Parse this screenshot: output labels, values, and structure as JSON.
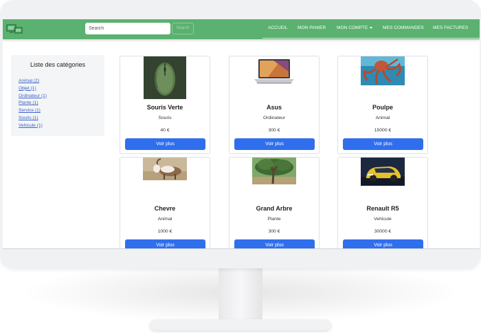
{
  "navbar": {
    "search_placeholder": "Search",
    "search_button": "Search",
    "links": [
      {
        "label": "Accueil"
      },
      {
        "label": "Mon panier"
      },
      {
        "label": "Mon compte"
      },
      {
        "label": "Mes commandes"
      },
      {
        "label": "Mes factures"
      }
    ]
  },
  "sidebar": {
    "title": "Liste des catégories",
    "categories": [
      "Animal (2)",
      "Objet (1)",
      "Ordinateur (1)",
      "Plante (1)",
      "Service (1)",
      "Souris (1)",
      "Vehicule (1)"
    ]
  },
  "products": [
    {
      "title": "Souris Verte",
      "category": "Souris",
      "price": "40 €",
      "button": "Voir plus",
      "image_icon": "mouse-image"
    },
    {
      "title": "Asus",
      "category": "Ordinateur",
      "price": "300 €",
      "button": "Voir plus",
      "image_icon": "laptop-image"
    },
    {
      "title": "Poulpe",
      "category": "Animal",
      "price": "15000 €",
      "button": "Voir plus",
      "image_icon": "octopus-image"
    },
    {
      "title": "Chevre",
      "category": "Animal",
      "price": "1000 €",
      "button": "Voir plus",
      "image_icon": "goat-image"
    },
    {
      "title": "Grand Arbre",
      "category": "Plante",
      "price": "300 €",
      "button": "Voir plus",
      "image_icon": "tree-image"
    },
    {
      "title": "Renault R5",
      "category": "Vehicule",
      "price": "30000 €",
      "button": "Voir plus",
      "image_icon": "car-image"
    }
  ],
  "colors": {
    "navbar": "#5bb16f",
    "primary_button": "#2f6fed",
    "link": "#3b62c9"
  }
}
